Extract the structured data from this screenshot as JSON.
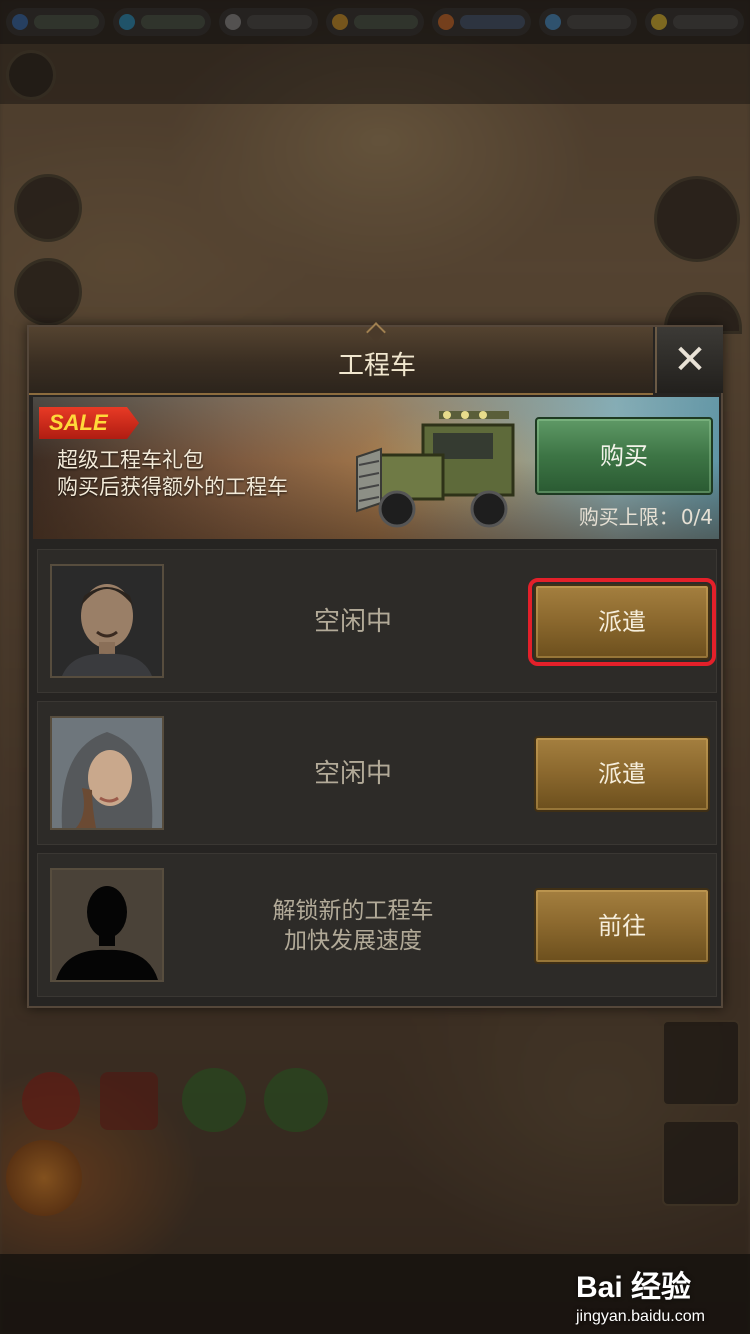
{
  "dialog": {
    "title": "工程车",
    "close_label": "✕"
  },
  "banner": {
    "sale_tag": "SALE",
    "line1": "超级工程车礼包",
    "line2": "购买后获得额外的工程车",
    "buy_label": "购买",
    "limit_label": "购买上限：",
    "limit_value": "0/4"
  },
  "rows": [
    {
      "status": "空闲中",
      "button": "派遣",
      "avatar": "male-commander-portrait"
    },
    {
      "status": "空闲中",
      "button": "派遣",
      "avatar": "hooded-woman-portrait"
    },
    {
      "status_line1": "解锁新的工程车",
      "status_line2": "加快发展速度",
      "button": "前往",
      "avatar": "locked-silhouette"
    }
  ],
  "watermark": {
    "logo": "Bai 经验",
    "url": "jingyan.baidu.com"
  },
  "colors": {
    "gold_button": "#8d6a2f",
    "green_button": "#3d7545",
    "sale_red": "#d12c1c",
    "highlight_red": "#e3202a"
  }
}
